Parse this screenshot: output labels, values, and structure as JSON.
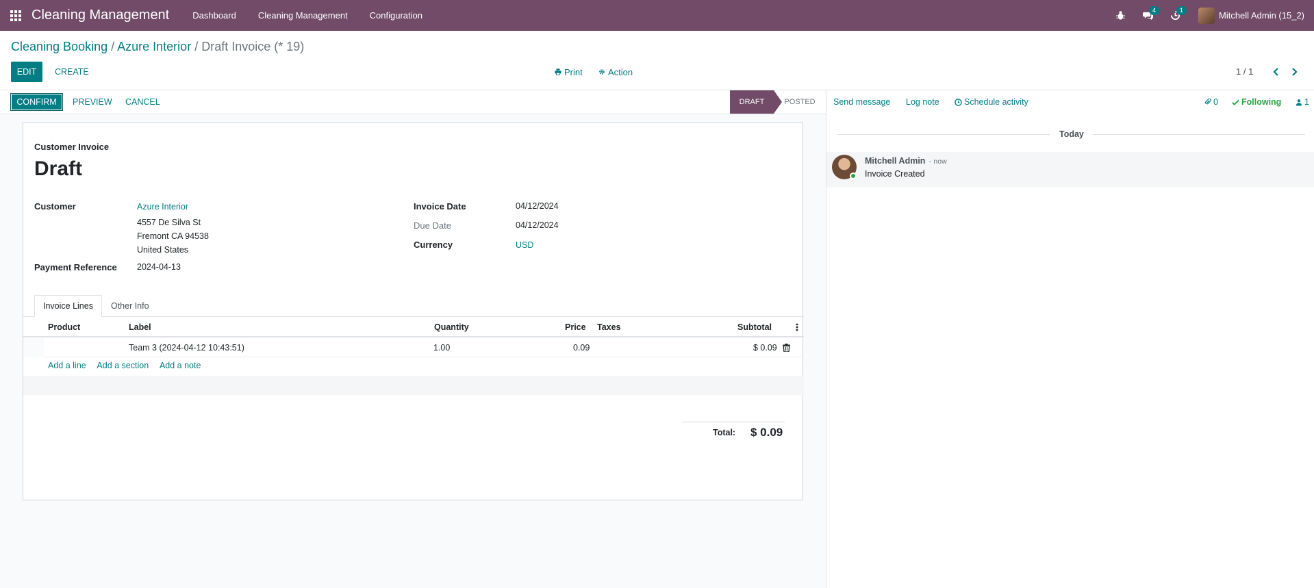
{
  "navbar": {
    "app_title": "Cleaning Management",
    "menu": [
      "Dashboard",
      "Cleaning Management",
      "Configuration"
    ],
    "chat_count": "4",
    "activity_count": "1",
    "user_name": "Mitchell Admin (15_2)",
    "icons": [
      "apps-grid-icon",
      "bug-icon",
      "chat-icon",
      "clock-icon"
    ]
  },
  "breadcrumb": {
    "level1": "Cleaning Booking",
    "level2": "Azure Interior",
    "current": "Draft Invoice (* 19)"
  },
  "control": {
    "edit_label": "EDIT",
    "create_label": "CREATE",
    "print_label": "Print",
    "action_label": "Action",
    "pager": "1 / 1"
  },
  "statusbar": {
    "confirm_label": "CONFIRM",
    "preview_label": "PREVIEW",
    "cancel_label": "CANCEL",
    "stage_active": "DRAFT",
    "stage_next": "POSTED"
  },
  "invoice": {
    "type": "Customer Invoice",
    "title": "Draft",
    "customer_label": "Customer",
    "customer_name": "Azure Interior",
    "address": [
      "4557 De Silva St",
      "Fremont CA 94538",
      "United States"
    ],
    "payment_ref_label": "Payment Reference",
    "payment_ref": "2024-04-13",
    "invoice_date_label": "Invoice Date",
    "invoice_date": "04/12/2024",
    "due_date_label": "Due Date",
    "due_date": "04/12/2024",
    "currency_label": "Currency",
    "currency": "USD"
  },
  "tabs": [
    "Invoice Lines",
    "Other Info"
  ],
  "lines": {
    "headers": {
      "product": "Product",
      "label": "Label",
      "quantity": "Quantity",
      "price": "Price",
      "taxes": "Taxes",
      "subtotal": "Subtotal"
    },
    "rows": [
      {
        "product": "",
        "label": "Team 3 (2024-04-12 10:43:51)",
        "quantity": "1.00",
        "price": "0.09",
        "taxes": "",
        "subtotal": "$ 0.09"
      }
    ],
    "add_line": "Add a line",
    "add_section": "Add a section",
    "add_note": "Add a note"
  },
  "totals": {
    "label": "Total:",
    "value": "$ 0.09"
  },
  "chatter": {
    "send_message": "Send message",
    "log_note": "Log note",
    "schedule_activity": "Schedule activity",
    "attachments": "0",
    "following": "Following",
    "followers": "1",
    "date_separator": "Today",
    "messages": [
      {
        "author": "Mitchell Admin",
        "time": "- now",
        "body": "Invoice Created"
      }
    ]
  }
}
